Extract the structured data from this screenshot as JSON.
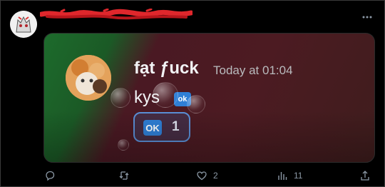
{
  "post": {
    "author_avatar_icon": "profile-avatar-icon",
    "author_name_redacted": true,
    "more_icon": "more-horizontal-icon"
  },
  "media": {
    "message": {
      "username": "fạt ƒuck",
      "timestamp": "Today at 01:04",
      "text": "kys",
      "inline_emoji": "ok"
    },
    "reaction": {
      "emoji": "OK",
      "count": "1"
    }
  },
  "actions": {
    "reply_icon": "reply-icon",
    "repost_icon": "repost-icon",
    "like_icon": "heart-icon",
    "like_count": "2",
    "views_icon": "views-icon",
    "views_count": "11",
    "share_icon": "share-icon"
  },
  "colors": {
    "background": "#000000",
    "card_green": "#1d6b2c",
    "card_maroon": "#4a1923",
    "reaction_border": "#5a8fd6",
    "emoji_blue": "#2f7fd6",
    "redaction_red": "#e0272c"
  }
}
